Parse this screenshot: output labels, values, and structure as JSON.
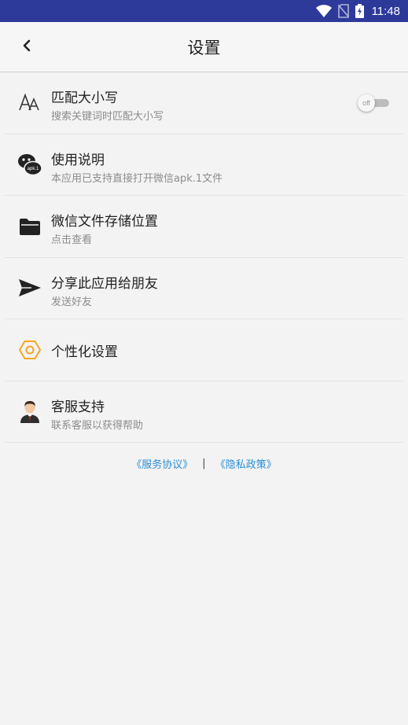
{
  "status_bar": {
    "time": "11:48",
    "icons": [
      "wifi-icon",
      "no-sim-icon",
      "battery-charging-icon"
    ]
  },
  "header": {
    "title": "设置",
    "back_icon": "chevron-left-icon"
  },
  "settings": [
    {
      "icon": "font-case-icon",
      "title": "匹配大小写",
      "subtitle": "搜索关键词时匹配大小写",
      "toggle": {
        "state": "off",
        "label": "off"
      }
    },
    {
      "icon": "wechat-apk-icon",
      "title": "使用说明",
      "subtitle": "本应用已支持直接打开微信apk.1文件"
    },
    {
      "icon": "folder-icon",
      "title": "微信文件存储位置",
      "subtitle": "点击查看"
    },
    {
      "icon": "send-icon",
      "title": "分享此应用给朋友",
      "subtitle": "发送好友"
    },
    {
      "icon": "hexagon-settings-icon",
      "title": "个性化设置"
    },
    {
      "icon": "customer-service-icon",
      "title": "客服支持",
      "subtitle": "联系客服以获得帮助"
    }
  ],
  "footer": {
    "service_agreement": "《服务协议》",
    "separator": "|",
    "privacy_policy": "《隐私政策》"
  },
  "colors": {
    "status_bar": "#2d3a9a",
    "link": "#2b8fd3",
    "accent_hexagon": "#f5a623"
  }
}
